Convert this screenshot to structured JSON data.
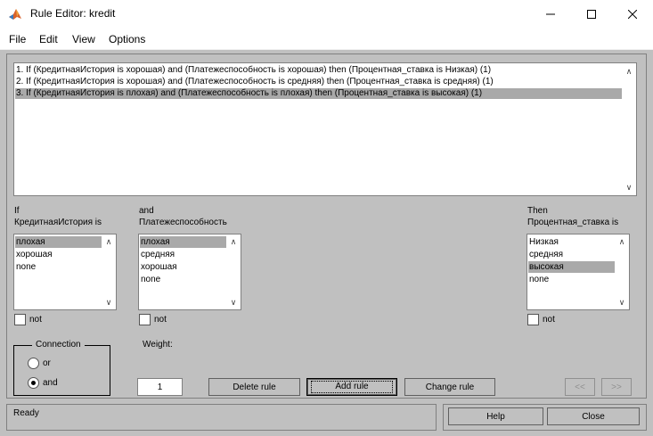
{
  "window": {
    "title": "Rule Editor: kredit",
    "minimize_icon": "minimize-icon",
    "maximize_icon": "maximize-icon",
    "close_icon": "close-icon"
  },
  "menu": [
    "File",
    "Edit",
    "View",
    "Options"
  ],
  "rules": [
    "1. If (КредитнаяИстория is хорошая) and (Платежеспособность is хорошая) then (Процентная_ставка is Низкая) (1)",
    "2. If (КредитнаяИстория is хорошая) and (Платежеспособность is средняя) then (Процентная_ставка is средняя) (1)",
    "3. If (КредитнаяИстория is плохая) and (Платежеспособность is плохая) then (Процентная_ставка is высокая) (1)"
  ],
  "selected_rule": 2,
  "if_block": {
    "keyword": "If",
    "variable": "КредитнаяИстория is",
    "options": [
      "плохая",
      "хорошая",
      "none"
    ],
    "selected": 0,
    "not_label": "not"
  },
  "and_block": {
    "keyword": "and",
    "variable": "Платежеспособность",
    "options": [
      "плохая",
      "средняя",
      "хорошая",
      "none"
    ],
    "selected": 0,
    "not_label": "not"
  },
  "then_block": {
    "keyword": "Then",
    "variable": "Процентная_ставка is",
    "options": [
      "Низкая",
      "средняя",
      "высокая",
      "none"
    ],
    "selected": 2,
    "not_label": "not"
  },
  "connection": {
    "title": "Connection",
    "options": [
      "or",
      "and"
    ],
    "selected": 1
  },
  "weight": {
    "label": "Weight:",
    "value": "1"
  },
  "buttons": {
    "delete": "Delete rule",
    "add": "Add rule",
    "change": "Change rule",
    "prev": "<<",
    "next": ">>",
    "help": "Help",
    "close": "Close"
  },
  "status": "Ready",
  "colors": {
    "panel": "#c0c0c0",
    "selection": "#a9a9a9",
    "titlebar": "#ffffff"
  }
}
